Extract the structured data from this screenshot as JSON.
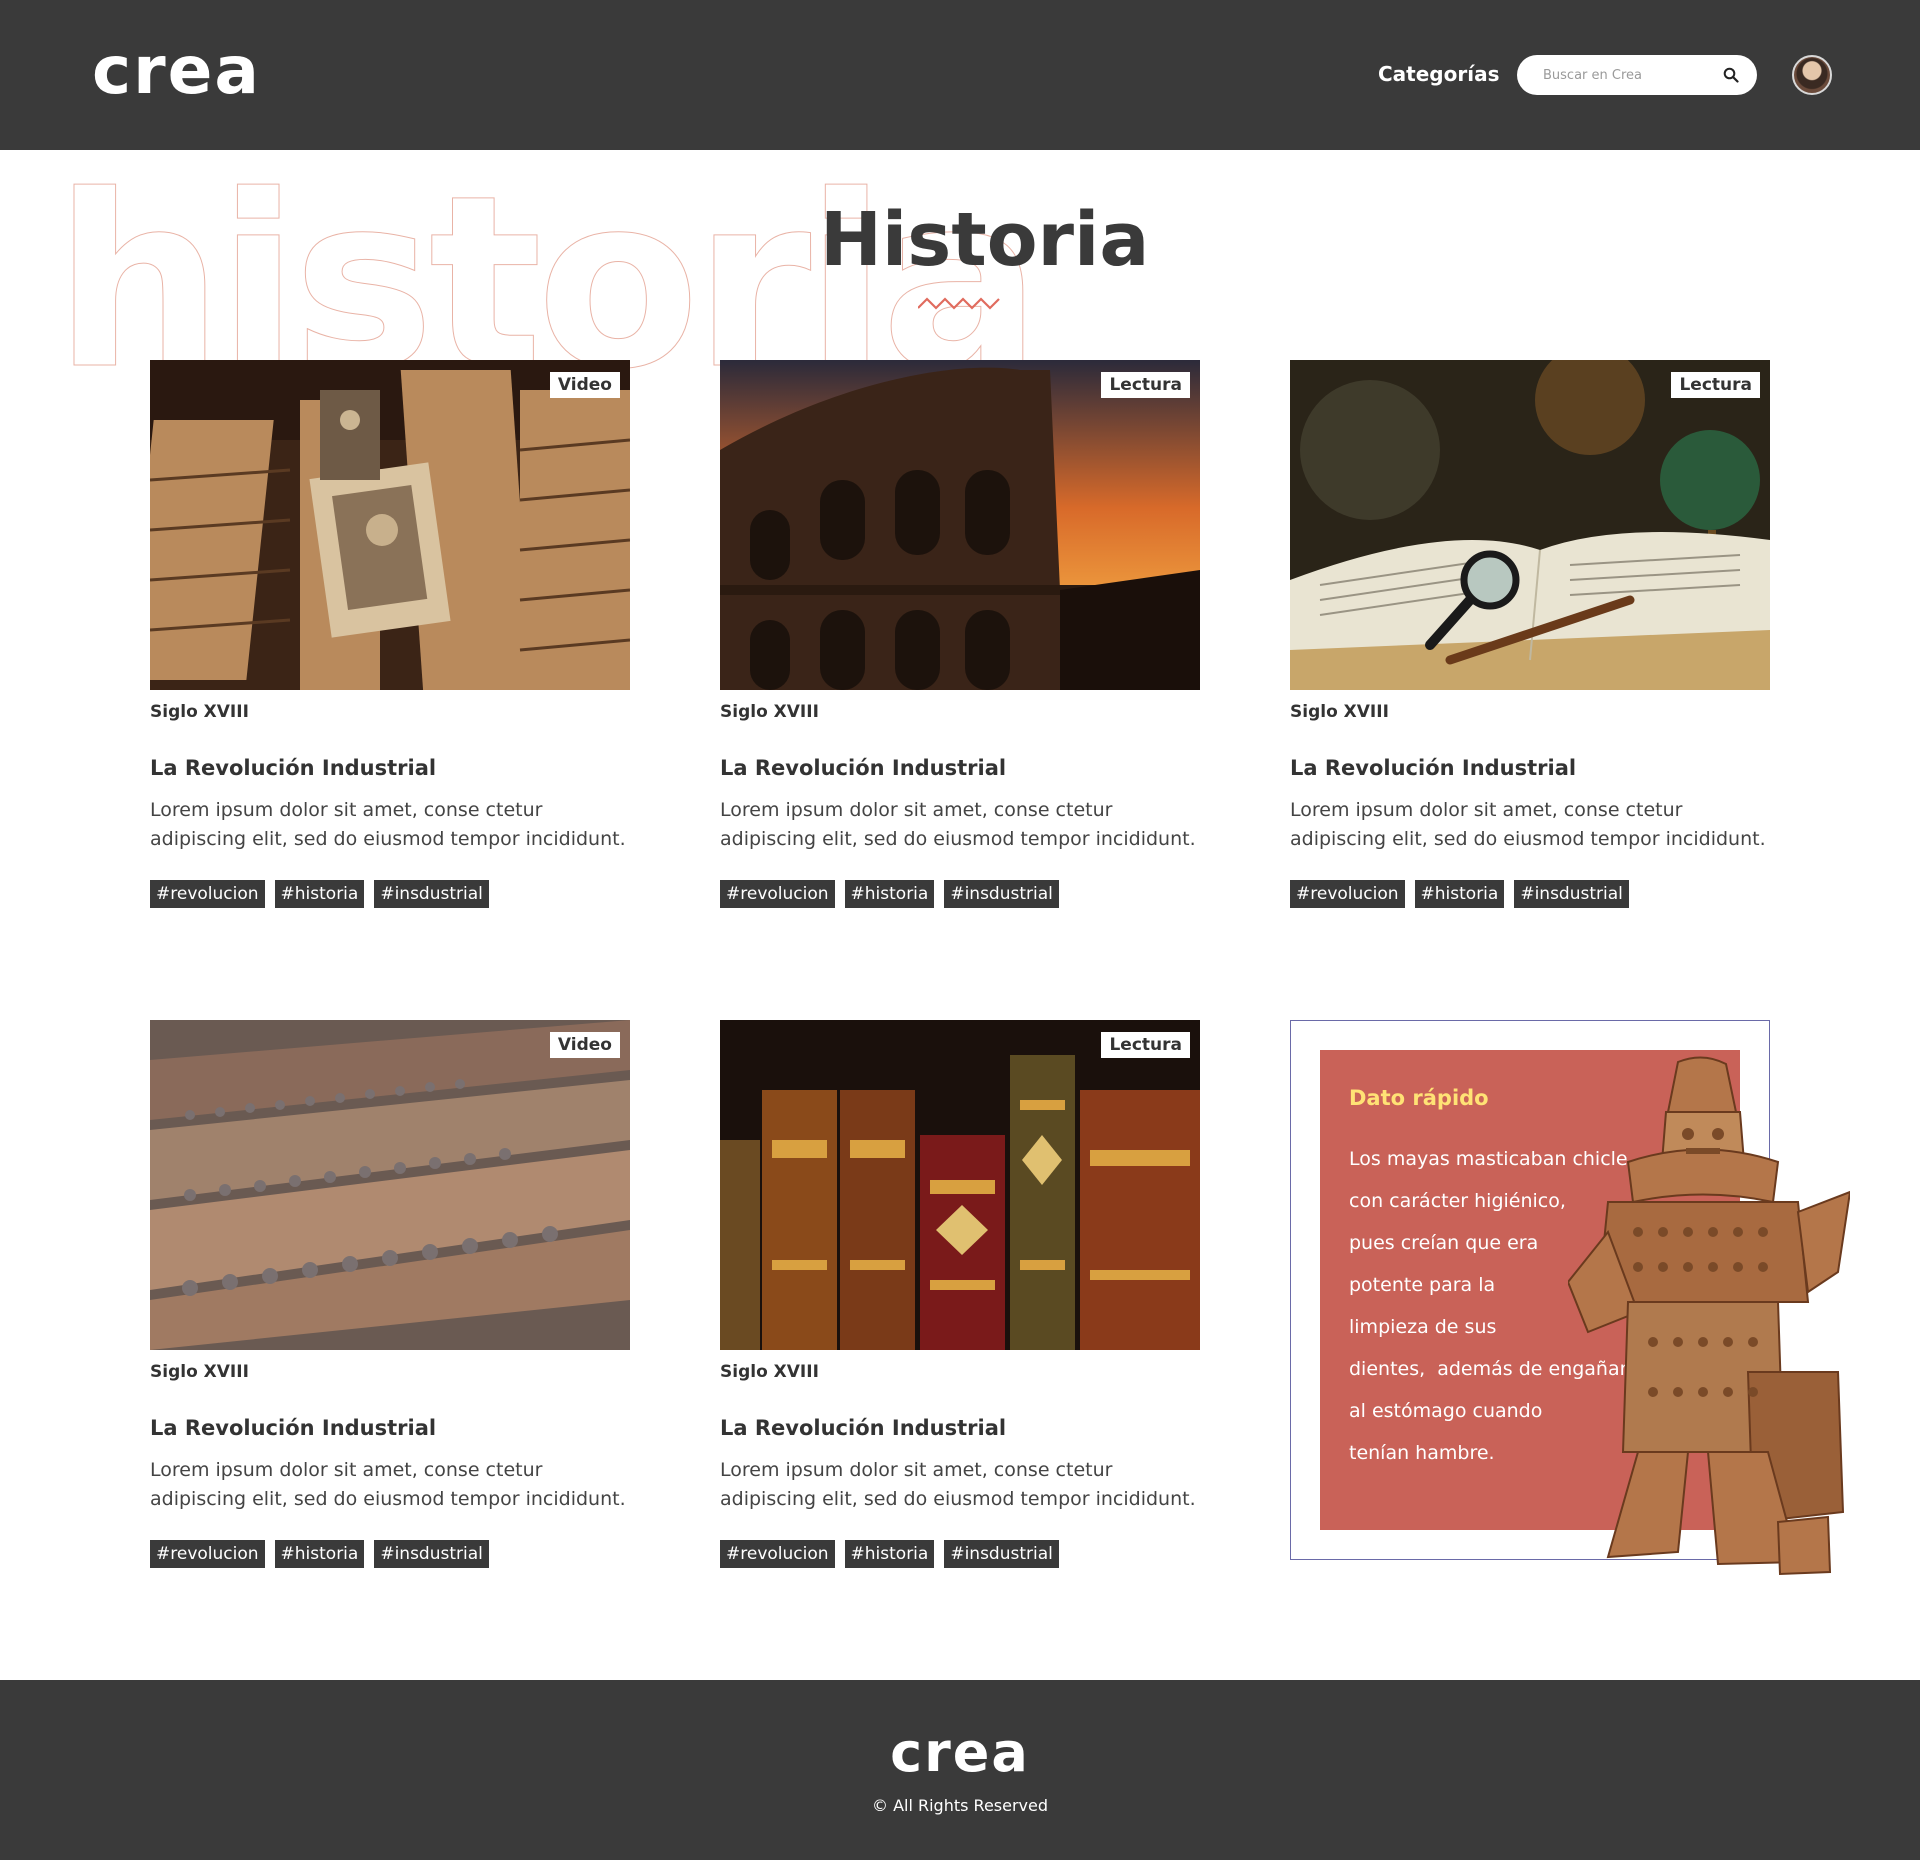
{
  "header": {
    "logo": "crea",
    "nav_categories": "Categorías",
    "search_placeholder": "Buscar en Crea"
  },
  "page": {
    "background_word": "historia",
    "title": "Historia"
  },
  "cards": [
    {
      "type": "Video",
      "era": "Siglo XVIII",
      "title": "La Revolución Industrial",
      "description": "Lorem ipsum dolor sit amet, conse ctetur adipiscing elit, sed do eiusmod tempor incididunt.",
      "tags": [
        "#revolucion",
        "#historia",
        "#insdustrial"
      ],
      "image": "archive-photographs-image"
    },
    {
      "type": "Lectura",
      "era": "Siglo XVIII",
      "title": "La Revolución Industrial",
      "description": "Lorem ipsum dolor sit amet, conse ctetur adipiscing elit, sed do eiusmod tempor incididunt.",
      "tags": [
        "#revolucion",
        "#historia",
        "#insdustrial"
      ],
      "image": "colosseum-sunset-image"
    },
    {
      "type": "Lectura",
      "era": "Siglo XVIII",
      "title": "La Revolución Industrial",
      "description": "Lorem ipsum dolor sit amet, conse ctetur adipiscing elit, sed do eiusmod tempor incididunt.",
      "tags": [
        "#revolucion",
        "#historia",
        "#insdustrial"
      ],
      "image": "book-magnifier-globe-image"
    },
    {
      "type": "Video",
      "era": "Siglo XVIII",
      "title": "La Revolución Industrial",
      "description": "Lorem ipsum dolor sit amet, conse ctetur adipiscing elit, sed do eiusmod tempor incididunt.",
      "tags": [
        "#revolucion",
        "#historia",
        "#insdustrial"
      ],
      "image": "terracotta-army-image"
    },
    {
      "type": "Lectura",
      "era": "Siglo XVIII",
      "title": "La Revolución Industrial",
      "description": "Lorem ipsum dolor sit amet, conse ctetur adipiscing elit, sed do eiusmod tempor incididunt.",
      "tags": [
        "#revolucion",
        "#historia",
        "#insdustrial"
      ],
      "image": "antique-books-image"
    }
  ],
  "dato": {
    "title": "Dato rápido",
    "lines": [
      "Los mayas masticaban chicle",
      "con carácter higiénico,",
      "pues creían que era",
      "potente para la",
      "limpieza de sus",
      "dientes,  además de engañar",
      "al estómago cuando",
      "tenían hambre."
    ]
  },
  "footer": {
    "logo": "crea",
    "copyright": "© All Rights Reserved"
  },
  "colors": {
    "header_bg": "#3a3a3a",
    "dato_bg": "#c96258",
    "dato_title": "#ffe275",
    "era_green": "#bff2b8",
    "era_red": "#f2b2b7",
    "era_blue": "#b5eaf0",
    "outline_word": "#e9b3a6",
    "zigzag": "#e06b5e"
  }
}
